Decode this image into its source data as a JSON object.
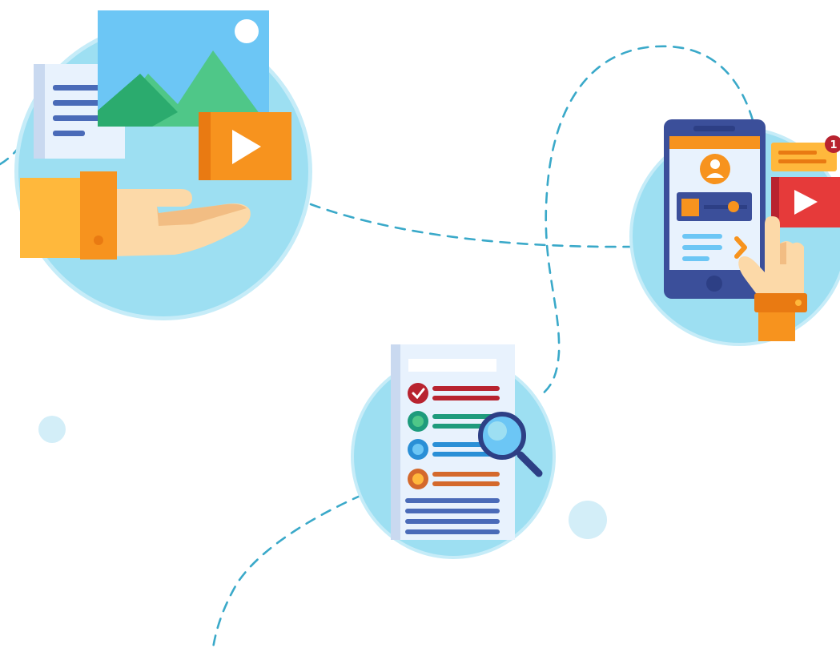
{
  "palette": {
    "circle": "#9ddff2",
    "circle_rim": "#c6ecf8",
    "path": "#3aa9c9",
    "dot": "#d3eef8",
    "sky": "#6cc6f5",
    "mountain_dark": "#2bab6e",
    "mountain_light": "#4fc788",
    "orange": "#f7931e",
    "orange_dark": "#e97a12",
    "orange_light": "#ffb83c",
    "skin": "#fcd9a8",
    "skin_shadow": "#f2bd83",
    "navy": "#3b4f9a",
    "navy_dark": "#2d3f85",
    "paper": "#e8f2fd",
    "paper_edge": "#c9d9f0",
    "line_blue": "#4a6bb8",
    "red": "#e63a3a",
    "red_dark": "#b8232f",
    "green_teal": "#1e9b7c",
    "blue": "#2a8fd6",
    "rust": "#d4692c",
    "white": "#ffffff"
  },
  "notification": {
    "badge_count": "1"
  }
}
